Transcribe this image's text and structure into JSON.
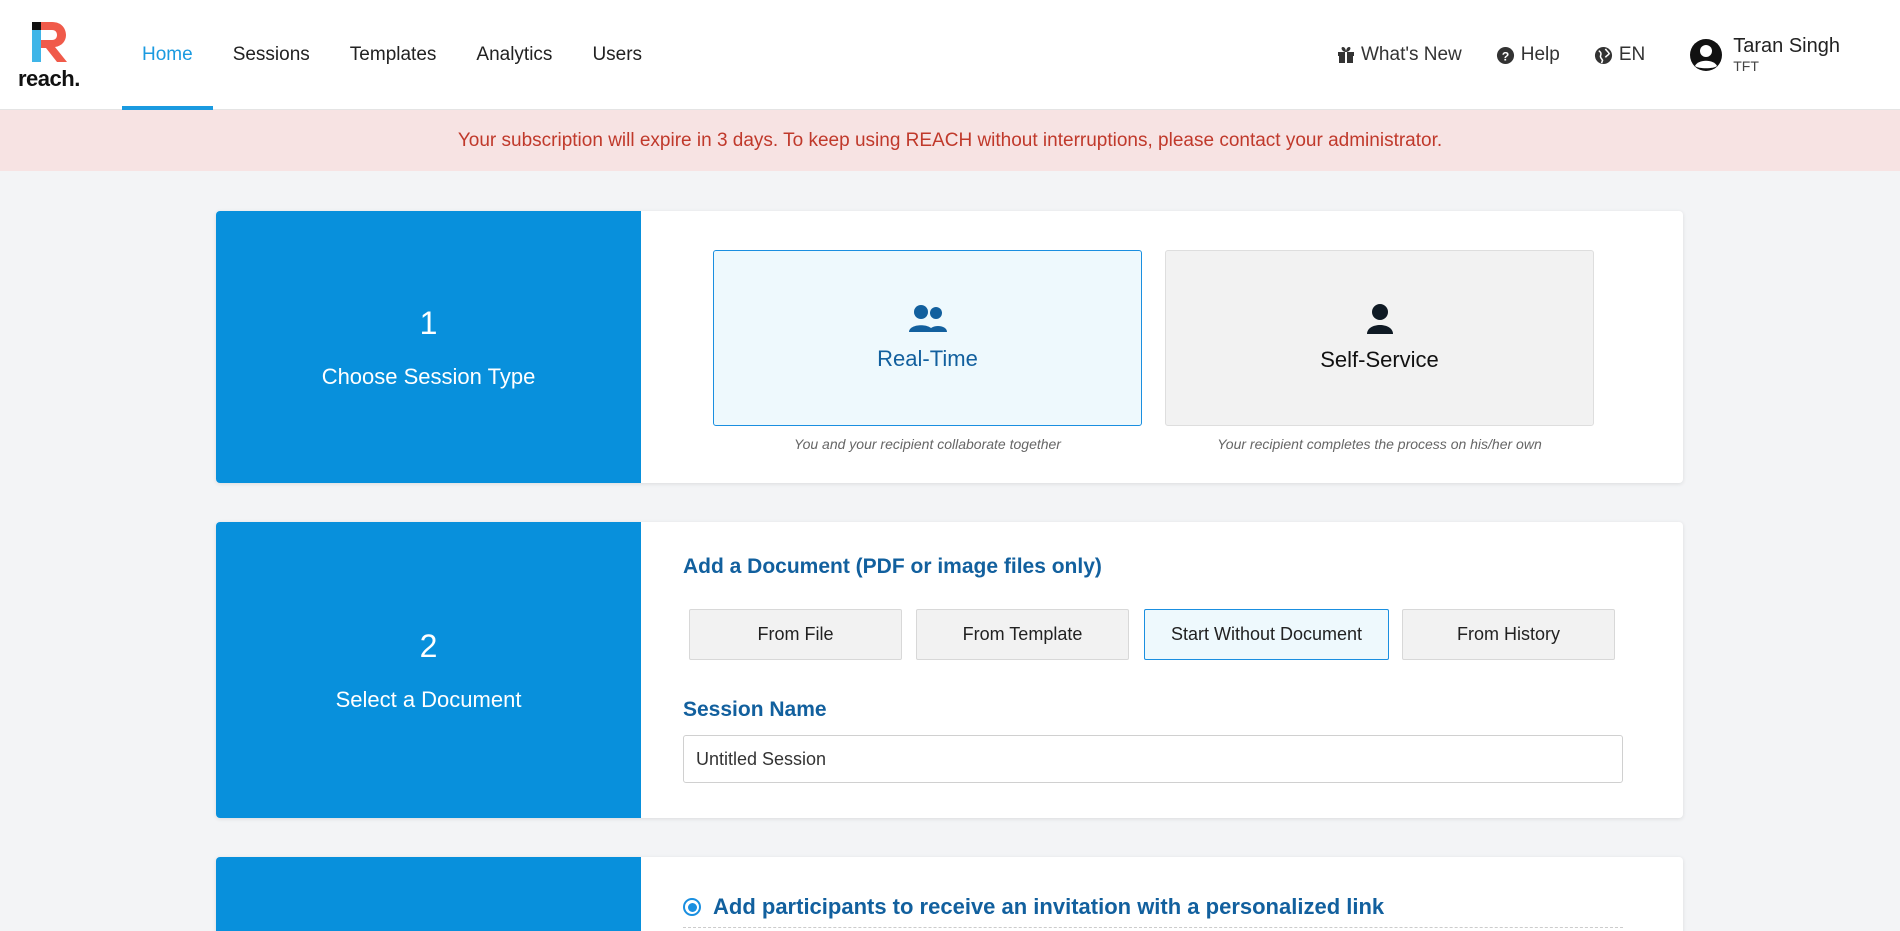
{
  "app": {
    "logo_text": "reach.",
    "brand_colors": {
      "primary": "#0890dc",
      "accent_red": "#f05a4a",
      "accent_blue": "#3fb5e8",
      "dark": "#12609e"
    }
  },
  "nav": {
    "items": [
      {
        "label": "Home",
        "active": true
      },
      {
        "label": "Sessions",
        "active": false
      },
      {
        "label": "Templates",
        "active": false
      },
      {
        "label": "Analytics",
        "active": false
      },
      {
        "label": "Users",
        "active": false
      }
    ]
  },
  "header_right": {
    "whats_new": "What's New",
    "help": "Help",
    "language": "EN",
    "user": {
      "name": "Taran Singh",
      "org": "TFT"
    }
  },
  "banner": {
    "text": "Your subscription will expire in 3 days. To keep using REACH without interruptions, please contact your administrator."
  },
  "steps": {
    "step1": {
      "number": "1",
      "title": "Choose Session Type",
      "options": [
        {
          "label": "Real-Time",
          "description": "You and your recipient collaborate together",
          "selected": true,
          "icon": "users-icon"
        },
        {
          "label": "Self-Service",
          "description": "Your recipient completes the process on his/her own",
          "selected": false,
          "icon": "user-icon"
        }
      ]
    },
    "step2": {
      "number": "2",
      "title": "Select a Document",
      "add_doc_label": "Add a Document (PDF or image files only)",
      "buttons": [
        {
          "label": "From File",
          "selected": false
        },
        {
          "label": "From Template",
          "selected": false
        },
        {
          "label": "Start Without Document",
          "selected": true
        },
        {
          "label": "From History",
          "selected": false
        }
      ],
      "session_name_label": "Session Name",
      "session_name_value": "Untitled Session"
    },
    "step3": {
      "radio_label": "Add participants to receive an invitation with a personalized link",
      "radio_selected": true
    }
  }
}
